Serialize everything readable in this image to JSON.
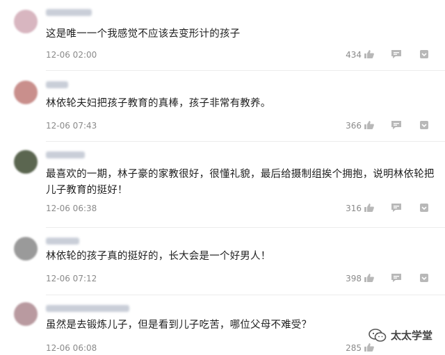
{
  "comments": [
    {
      "text": "这是唯一一个我感觉不应该去变形计的孩子",
      "time": "12-06 02:00",
      "likes": "434",
      "avatar_color": "#d8b6c0"
    },
    {
      "text": "林依轮夫妇把孩子教育的真棒，孩子非常有教养。",
      "time": "12-06 07:43",
      "likes": "366",
      "avatar_color": "#c98f8c"
    },
    {
      "text": "最喜欢的一期，林子豪的家教很好，很懂礼貌，最后给摄制组挨个拥抱，说明林依轮把儿子教育的挺好！",
      "time": "12-06 06:38",
      "likes": "316",
      "avatar_color": "#5b6650"
    },
    {
      "text": "林依轮的孩子真的挺好的，长大会是一个好男人！",
      "time": "12-06 07:12",
      "likes": "398",
      "avatar_color": "#9a9a9a"
    },
    {
      "text": "虽然是去锻炼儿子，但是看到儿子吃苦，哪位父母不难受？",
      "time": "12-06 06:08",
      "likes": "285",
      "avatar_color": "#b99aa0"
    }
  ],
  "watermark": {
    "label": "太太学堂",
    "icon": "wechat-icon"
  },
  "icons": {
    "like": "thumbs-up-icon",
    "reply": "comment-bubble-icon",
    "more": "more-icon"
  }
}
